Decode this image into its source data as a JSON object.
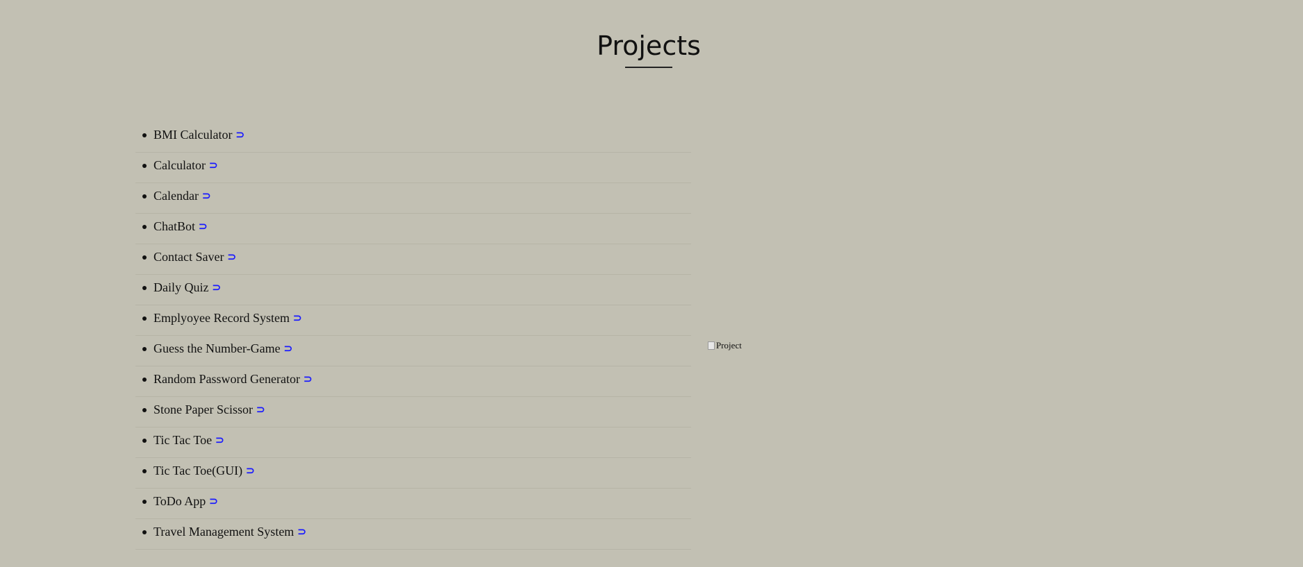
{
  "page": {
    "title": "Projects"
  },
  "projects": [
    {
      "label": "BMI Calculator",
      "icon": "⊃"
    },
    {
      "label": "Calculator",
      "icon": "⊃"
    },
    {
      "label": "Calendar",
      "icon": "⊃"
    },
    {
      "label": "ChatBot",
      "icon": "⊃"
    },
    {
      "label": "Contact Saver",
      "icon": "⊃"
    },
    {
      "label": "Daily Quiz",
      "icon": "⊃"
    },
    {
      "label": "Emplyoyee Record System",
      "icon": "⊃"
    },
    {
      "label": "Guess the Number-Game",
      "icon": "⊃"
    },
    {
      "label": "Random Password Generator",
      "icon": "⊃"
    },
    {
      "label": "Stone Paper Scissor",
      "icon": "⊃"
    },
    {
      "label": "Tic Tac Toe",
      "icon": "⊃"
    },
    {
      "label": "Tic Tac Toe(GUI)",
      "icon": "⊃"
    },
    {
      "label": "ToDo App",
      "icon": "⊃"
    },
    {
      "label": "Travel Management System",
      "icon": "⊃"
    }
  ],
  "preview": {
    "alt_text": "Project"
  },
  "colors": {
    "background": "#c2c0b3",
    "link_icon": "#1a1aff"
  }
}
